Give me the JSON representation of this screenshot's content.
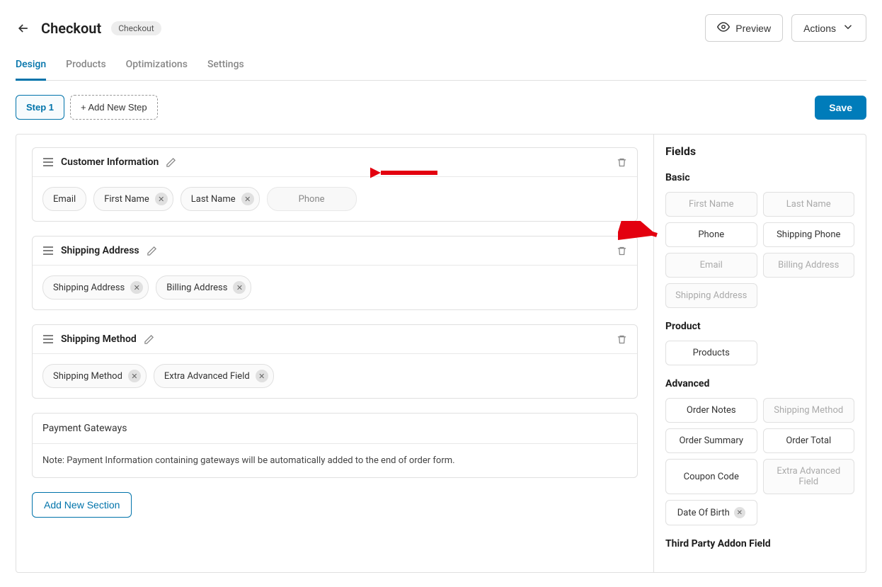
{
  "header": {
    "title": "Checkout",
    "badge": "Checkout",
    "preview_label": "Preview",
    "actions_label": "Actions"
  },
  "tabs": [
    "Design",
    "Products",
    "Optimizations",
    "Settings"
  ],
  "steps": {
    "step1": "Step 1",
    "add": "+ Add New Step",
    "save": "Save"
  },
  "sections": [
    {
      "title": "Customer Information",
      "chips": [
        {
          "label": "Email",
          "removable": false
        },
        {
          "label": "First Name",
          "removable": true
        },
        {
          "label": "Last Name",
          "removable": true
        },
        {
          "label": "Phone",
          "ghost": true
        }
      ]
    },
    {
      "title": "Shipping Address",
      "chips": [
        {
          "label": "Shipping Address",
          "removable": true
        },
        {
          "label": "Billing Address",
          "removable": true
        }
      ]
    },
    {
      "title": "Shipping Method",
      "chips": [
        {
          "label": "Shipping Method",
          "removable": true
        },
        {
          "label": "Extra Advanced Field",
          "removable": true
        }
      ]
    }
  ],
  "payment": {
    "title": "Payment Gateways",
    "note": "Note: Payment Information containing gateways will be automatically added to the end of order form."
  },
  "add_section": "Add New Section",
  "fields": {
    "heading": "Fields",
    "groups": [
      {
        "title": "Basic",
        "items": [
          {
            "label": "First Name",
            "disabled": true
          },
          {
            "label": "Last Name",
            "disabled": true
          },
          {
            "label": "Phone",
            "disabled": false
          },
          {
            "label": "Shipping Phone",
            "disabled": false
          },
          {
            "label": "Email",
            "disabled": true
          },
          {
            "label": "Billing Address",
            "disabled": true
          },
          {
            "label": "Shipping Address",
            "disabled": true
          }
        ]
      },
      {
        "title": "Product",
        "items": [
          {
            "label": "Products",
            "disabled": false
          }
        ]
      },
      {
        "title": "Advanced",
        "items": [
          {
            "label": "Order Notes",
            "disabled": false
          },
          {
            "label": "Shipping Method",
            "disabled": true
          },
          {
            "label": "Order Summary",
            "disabled": false
          },
          {
            "label": "Order Total",
            "disabled": false
          },
          {
            "label": "Coupon Code",
            "disabled": false
          },
          {
            "label": "Extra Advanced Field",
            "disabled": true
          },
          {
            "label": "Date Of Birth",
            "disabled": false,
            "removable": true
          }
        ]
      },
      {
        "title": "Third Party Addon Field",
        "items": []
      }
    ]
  }
}
